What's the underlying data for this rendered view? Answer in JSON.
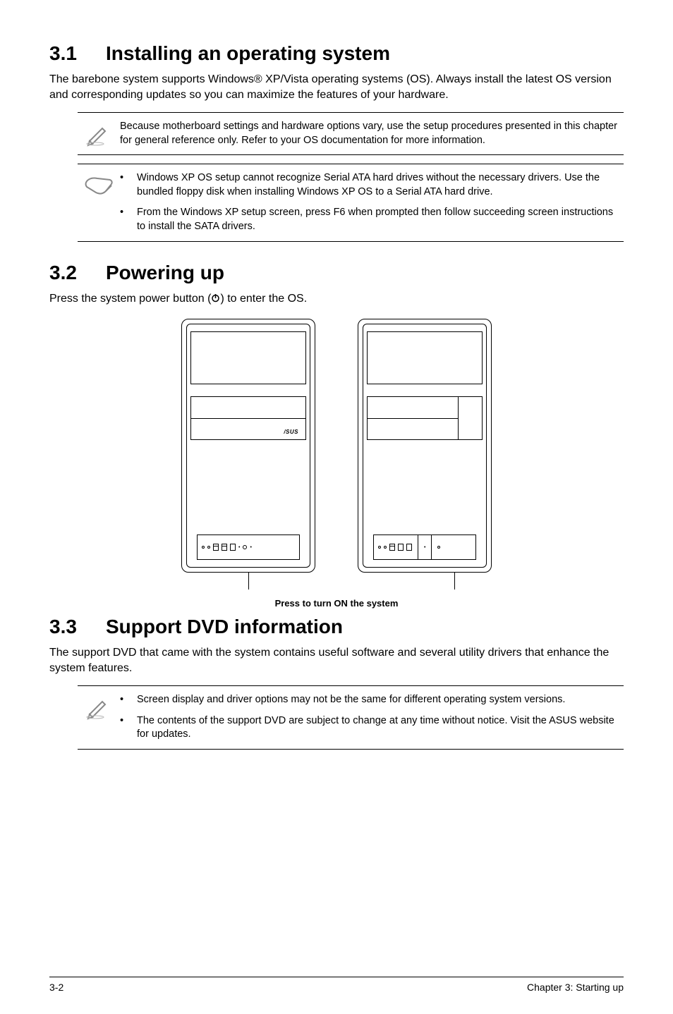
{
  "s1": {
    "num": "3.1",
    "title": "Installing an operating system",
    "para": "The barebone system supports Windows® XP/Vista operating systems (OS). Always install the latest OS version and corresponding updates so you can maximize the features of your hardware.",
    "note1": "Because motherboard settings and hardware options vary, use the setup procedures presented in this chapter for general reference only. Refer to your OS documentation for more information.",
    "note2a": "Windows XP OS setup cannot recognize Serial ATA hard drives without the necessary drivers. Use the bundled floppy disk when installing Windows XP OS to a Serial ATA hard drive.",
    "note2b": "From the Windows XP setup screen, press F6 when prompted then follow succeeding screen instructions to install the SATA drivers."
  },
  "s2": {
    "num": "3.2",
    "title": "Powering up",
    "para_a": "Press the system power button (",
    "para_b": ") to enter the OS.",
    "logo": "/SUS",
    "caption": "Press to turn ON the system"
  },
  "s3": {
    "num": "3.3",
    "title": "Support DVD information",
    "para": "The support DVD that came with the system contains useful software and several utility drivers that enhance the system features.",
    "note1": "Screen display and driver options may not be the same for different operating system versions.",
    "note2": "The contents of the support DVD are subject to change at any time without notice. Visit the ASUS website for updates."
  },
  "footer": {
    "left": "3-2",
    "right": "Chapter 3: Starting up"
  }
}
